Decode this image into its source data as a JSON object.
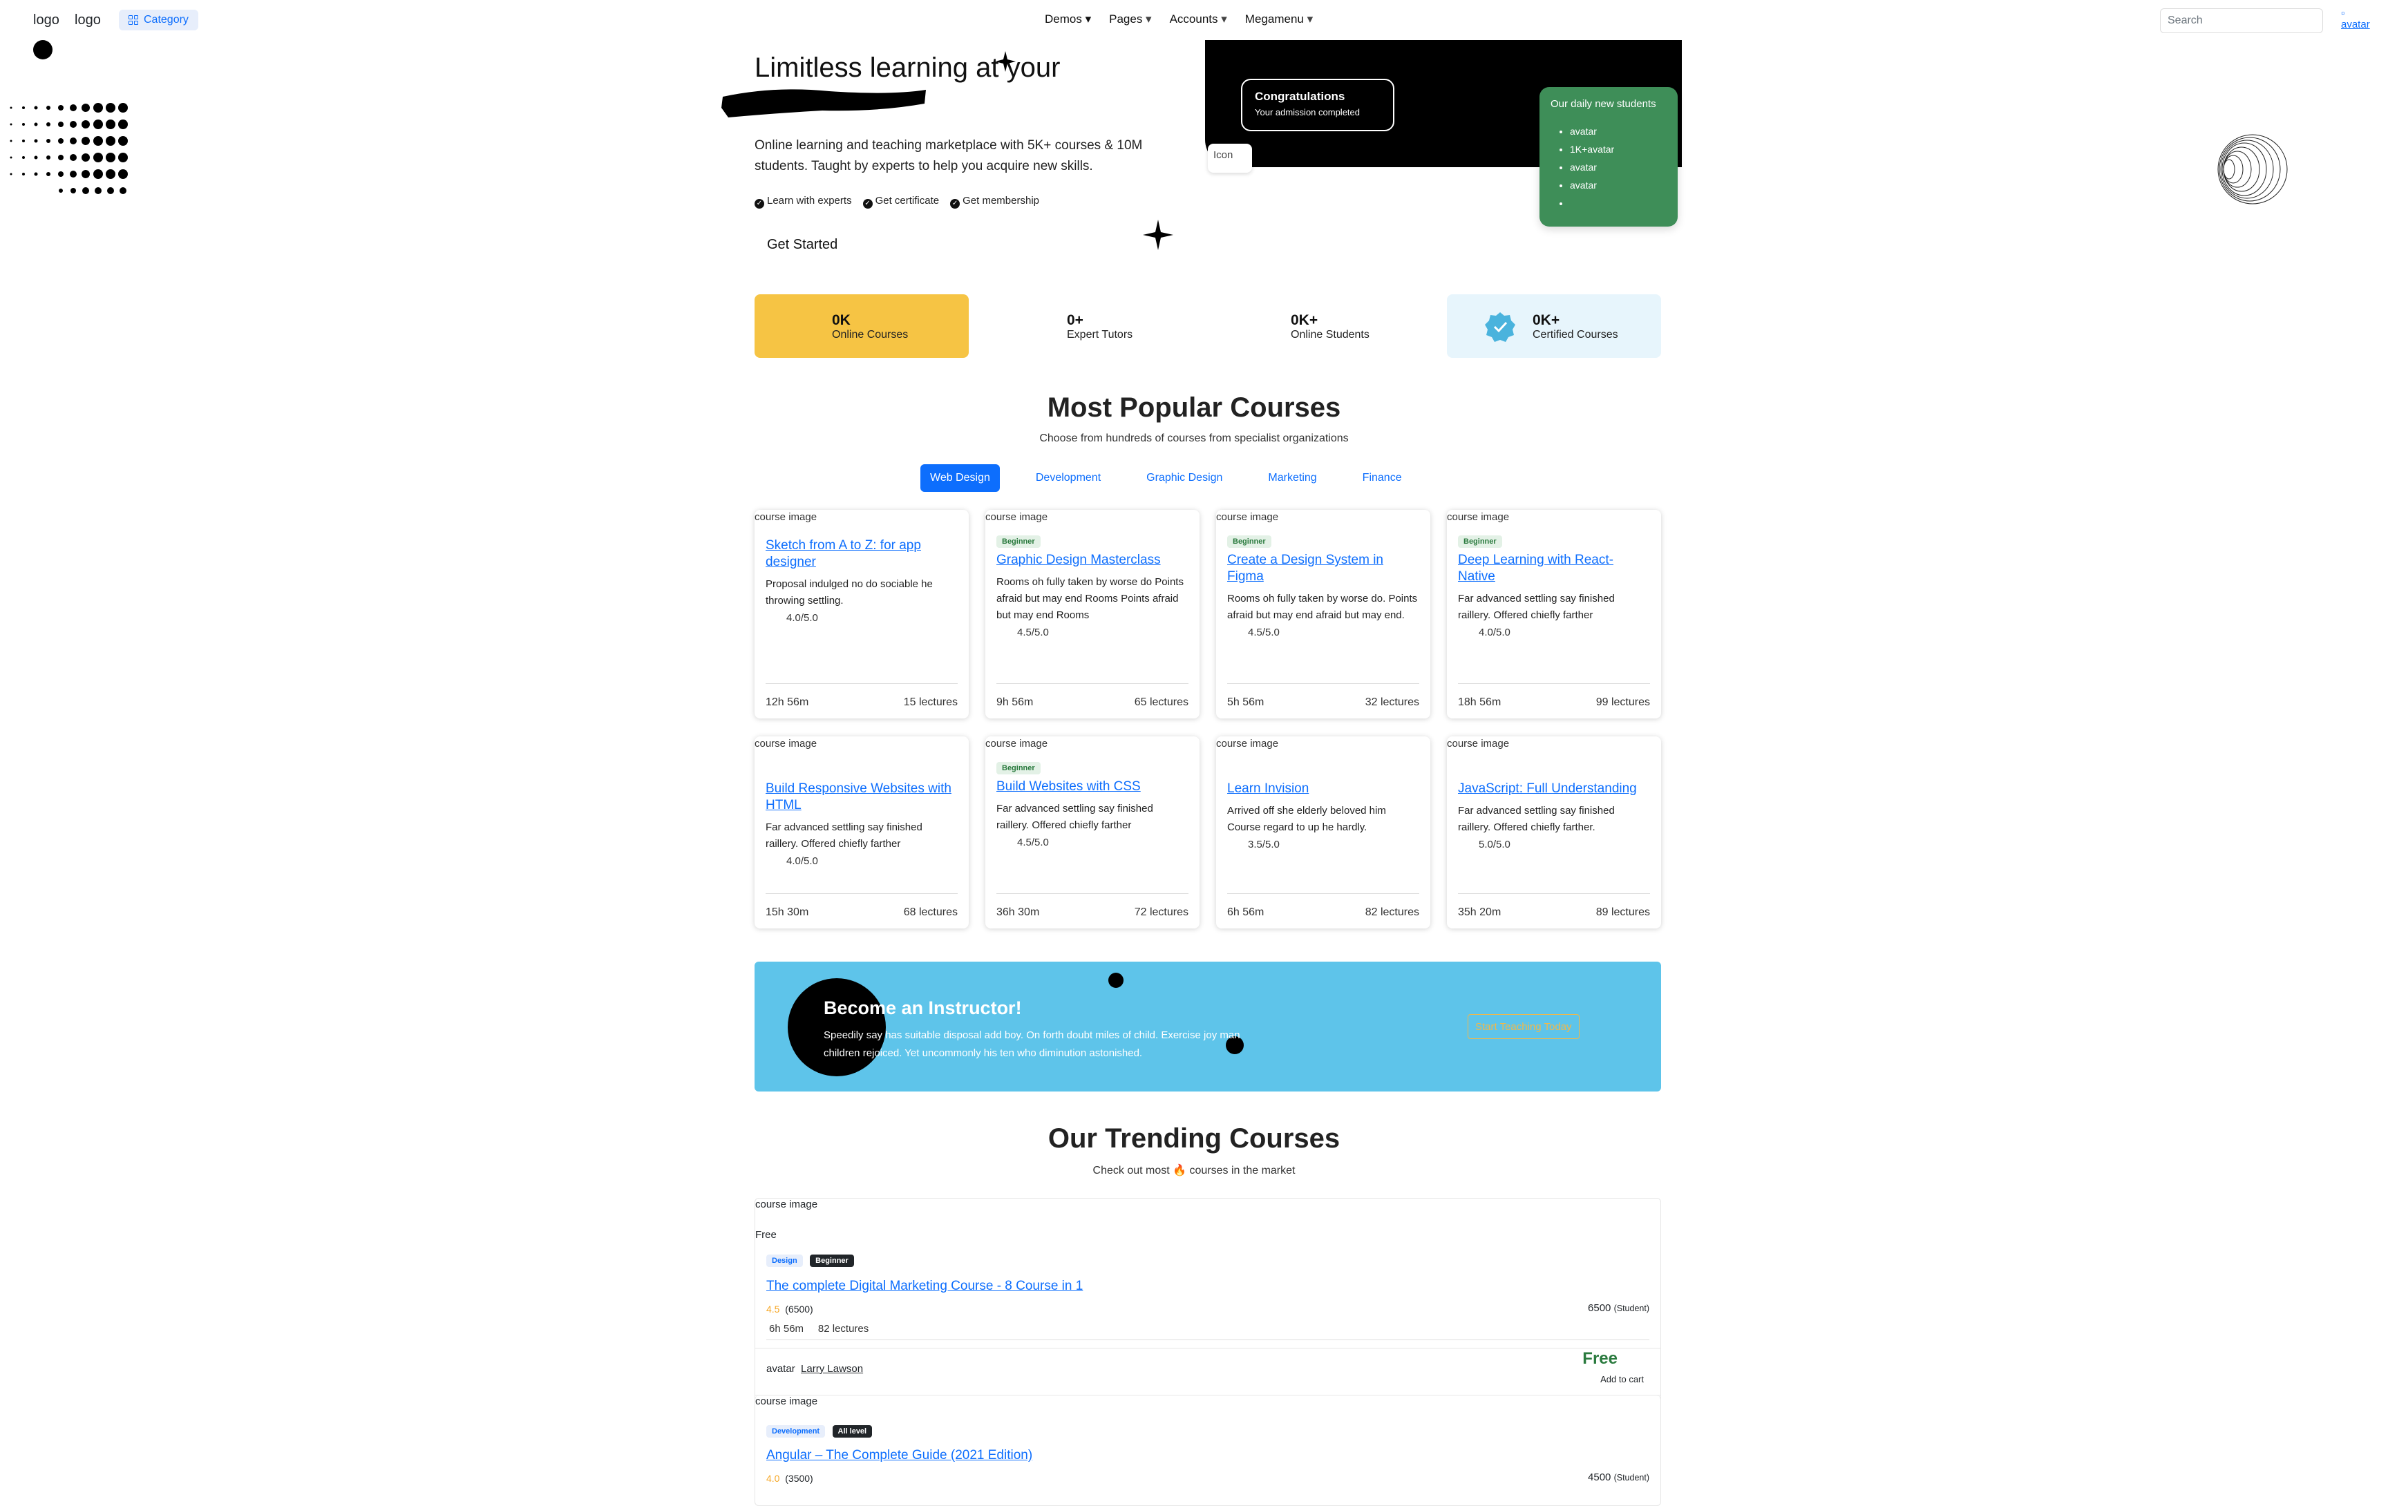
{
  "navbar": {
    "logo_alt": "logo",
    "logo_alt_2": "logo",
    "category_label": "Category",
    "menu": [
      "Demos",
      "Pages",
      "Accounts",
      "Megamenu"
    ],
    "search_placeholder": "Search",
    "avatar_alt": "avatar"
  },
  "hero": {
    "title": "Limitless learning at your",
    "description": "Online learning and teaching marketplace with 5K+ courses & 10M students. Taught by experts to help you acquire new skills.",
    "features": [
      "Learn with experts",
      "Get certificate",
      "Get membership"
    ],
    "cta": "Get Started",
    "congrats_title": "Congratulations",
    "congrats_sub": "Your admission completed",
    "icon_alt": "Icon",
    "daily_title": "Our daily new students",
    "daily_avatars": [
      "avatar",
      "1K+avatar",
      "avatar",
      "avatar",
      ""
    ]
  },
  "counters": [
    {
      "value": "0K",
      "label": "Online Courses"
    },
    {
      "value": "0+",
      "label": "Expert Tutors"
    },
    {
      "value": "0K+",
      "label": "Online Students"
    },
    {
      "value": "0K+",
      "label": "Certified Courses"
    }
  ],
  "popular": {
    "title": "Most Popular Courses",
    "subtitle": "Choose from hundreds of courses from specialist organizations",
    "tabs": [
      "Web Design",
      "Development",
      "Graphic Design",
      "Marketing",
      "Finance"
    ],
    "img_alt": "course image",
    "courses": [
      {
        "badge": "",
        "title": "Sketch from A to Z: for app designer",
        "desc": "Proposal indulged no do sociable he throwing settling.",
        "rating": "4.0/5.0",
        "time": "12h 56m",
        "lectures": "15 lectures"
      },
      {
        "badge": "Beginner",
        "title": "Graphic Design Masterclass",
        "desc": "Rooms oh fully taken by worse do Points afraid but may end Rooms Points afraid but may end Rooms",
        "rating": "4.5/5.0",
        "time": "9h 56m",
        "lectures": "65 lectures"
      },
      {
        "badge": "Beginner",
        "title": "Create a Design System in Figma",
        "desc": "Rooms oh fully taken by worse do. Points afraid but may end afraid but may end.",
        "rating": "4.5/5.0",
        "time": "5h 56m",
        "lectures": "32 lectures"
      },
      {
        "badge": "Beginner",
        "title": "Deep Learning with React-Native",
        "desc": "Far advanced settling say finished raillery. Offered chiefly farther",
        "rating": "4.0/5.0",
        "time": "18h 56m",
        "lectures": "99 lectures"
      },
      {
        "badge": "",
        "title": "Build Responsive Websites with HTML",
        "desc": "Far advanced settling say finished raillery. Offered chiefly farther",
        "rating": "4.0/5.0",
        "time": "15h 30m",
        "lectures": "68 lectures"
      },
      {
        "badge": "Beginner",
        "title": "Build Websites with CSS",
        "desc": "Far advanced settling say finished raillery. Offered chiefly farther",
        "rating": "4.5/5.0",
        "time": "36h 30m",
        "lectures": "72 lectures"
      },
      {
        "badge": "",
        "title": "Learn Invision",
        "desc": "Arrived off she elderly beloved him Course regard to up he hardly.",
        "rating": "3.5/5.0",
        "time": "6h 56m",
        "lectures": "82 lectures"
      },
      {
        "badge": "",
        "title": "JavaScript: Full Understanding",
        "desc": "Far advanced settling say finished raillery. Offered chiefly farther.",
        "rating": "5.0/5.0",
        "time": "35h 20m",
        "lectures": "89 lectures"
      }
    ]
  },
  "instructor": {
    "title": "Become an Instructor!",
    "text": "Speedily say has suitable disposal add boy. On forth doubt miles of child. Exercise joy man children rejoiced. Yet uncommonly his ten who diminution astonished.",
    "button": "Start Teaching Today"
  },
  "trending": {
    "title": "Our Trending Courses",
    "subtitle_pre": "Check out most",
    "subtitle_post": "courses in the market",
    "fire_icon": "🔥",
    "img_alt": "course image",
    "item1": {
      "price_tag": "Free",
      "badge1": "Design",
      "badge2": "Beginner",
      "title": "The complete Digital Marketing Course - 8 Course in 1",
      "rating": "4.5",
      "reviews": "(6500)",
      "students": "6500",
      "students_label": "(Student)",
      "time": "6h 56m",
      "lectures": "82 lectures",
      "avatar_alt": "avatar",
      "author": "Larry Lawson",
      "price": "Free",
      "cart": "Add to cart"
    },
    "item2": {
      "badge1": "Development",
      "badge2": "All level",
      "title": "Angular – The Complete Guide (2021 Edition)",
      "rating": "4.0",
      "reviews": "(3500)",
      "students": "4500",
      "students_label": "(Student)"
    }
  },
  "colors": {
    "counter_yellow": "#f6c444",
    "counter_blue": "#e7f5fc",
    "instructor_bg": "#5ec4ea",
    "primary": "#0d6efd",
    "daily_green": "#3e8e58"
  }
}
